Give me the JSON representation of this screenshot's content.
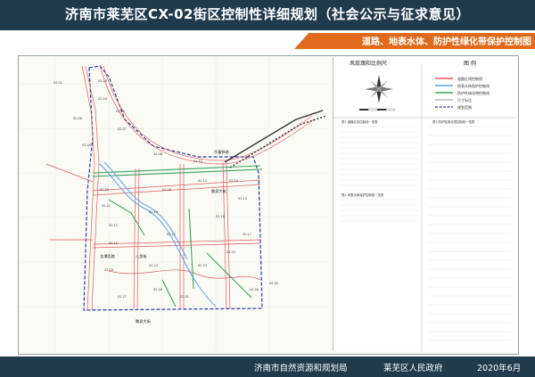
{
  "header": {
    "title": "济南市莱芜区CX-02街区控制性详细规划（社会公示与征求意见）",
    "subtitle": "道路、地表水体、防护性绿化带保护控制图"
  },
  "map": {
    "road_labels": [
      "华童铁路",
      "鹏泉大街",
      "八里街",
      "龙潭西路",
      "鹏泉大街"
    ],
    "block_codes": [
      "02-01",
      "02-03",
      "02-04",
      "02-05",
      "02-06",
      "02-07",
      "02-08",
      "02-09",
      "02-10",
      "02-11",
      "02-12",
      "02-13",
      "02-14",
      "02-15",
      "02-16",
      "02-17",
      "02-18",
      "02-19",
      "02-20",
      "02-21",
      "02-22",
      "02-23",
      "02-24",
      "02-25",
      "02-26",
      "02-27",
      "02-28",
      "02-29",
      "02-30",
      "02-31"
    ]
  },
  "legend": {
    "scale_title": "风玫瑰和比例尺",
    "legend_title": "图  例",
    "items": [
      "道路红线控制线",
      "地表水体保护控制线",
      "防护性绿化带控制线",
      "尺寸标注",
      "规划范围"
    ],
    "table1_title": "表1 道路红线控制线一览表",
    "table2_title": "表2 地表水体保护控制线一览表",
    "table3_title": "表3 防护性绿化带控制线一览表"
  },
  "footer": {
    "org1": "济南市自然资源和规划局",
    "org2": "莱芜区人民政府",
    "date": "2020年6月"
  },
  "colors": {
    "header_bg": "#1f3b4d",
    "accent": "#e06a1b",
    "road_red": "#e05a5a",
    "water_blue": "#5aa0e0",
    "green_belt": "#3aa35a",
    "boundary": "#2a3a9a"
  }
}
